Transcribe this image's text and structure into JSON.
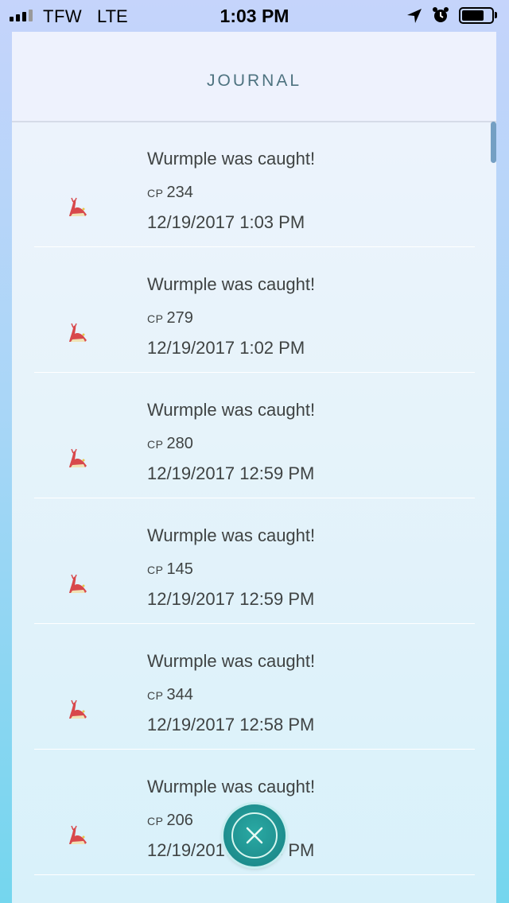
{
  "status_bar": {
    "carrier": "TFW",
    "network": "LTE",
    "time": "1:03 PM",
    "signal_bars": 3,
    "battery_level": 0.75,
    "icons": [
      "location-arrow-icon",
      "alarm-clock-icon",
      "battery-icon"
    ]
  },
  "header": {
    "title": "JOURNAL"
  },
  "entries": [
    {
      "title": "Wurmple was caught!",
      "cp_label": "CP",
      "cp": "234",
      "time": "12/19/2017 1:03 PM",
      "icon": "wurmple-icon"
    },
    {
      "title": "Wurmple was caught!",
      "cp_label": "CP",
      "cp": "279",
      "time": "12/19/2017 1:02 PM",
      "icon": "wurmple-icon"
    },
    {
      "title": "Wurmple was caught!",
      "cp_label": "CP",
      "cp": "280",
      "time": "12/19/2017 12:59 PM",
      "icon": "wurmple-icon"
    },
    {
      "title": "Wurmple was caught!",
      "cp_label": "CP",
      "cp": "145",
      "time": "12/19/2017 12:59 PM",
      "icon": "wurmple-icon"
    },
    {
      "title": "Wurmple was caught!",
      "cp_label": "CP",
      "cp": "344",
      "time": "12/19/2017 12:58 PM",
      "icon": "wurmple-icon"
    },
    {
      "title": "Wurmple was caught!",
      "cp_label": "CP",
      "cp": "206",
      "time": "12/19/2017 12:58 PM",
      "icon": "wurmple-icon"
    }
  ],
  "close_button": {
    "icon": "close-icon"
  },
  "colors": {
    "title": "#4e7380",
    "text": "#3f4343",
    "close_button": "#1d8d8d",
    "wurmple_red": "#d8484b"
  }
}
